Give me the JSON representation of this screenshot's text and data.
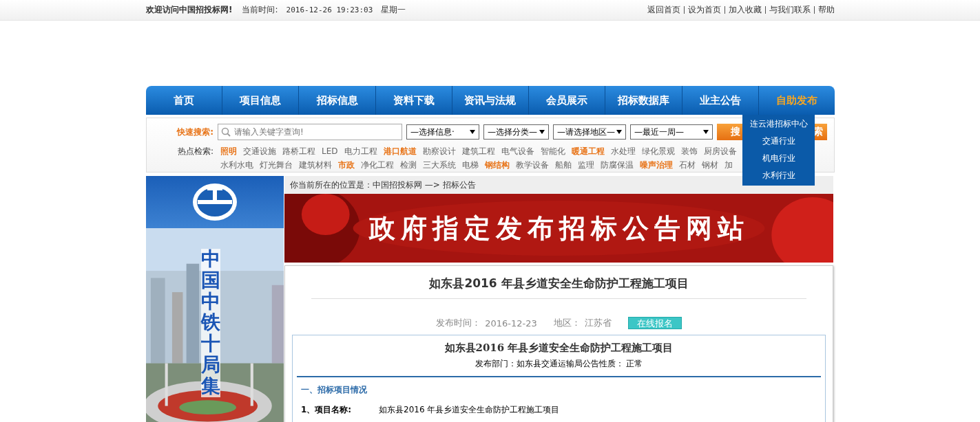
{
  "top_bar": {
    "welcome": "欢迎访问中国招投标网!",
    "time_label": "当前时间:",
    "time": "2016-12-26 19:23:03",
    "weekday": "星期一",
    "links": [
      "返回首页",
      "设为首页",
      "加入收藏",
      "与我们联系",
      "帮助"
    ]
  },
  "nav": [
    {
      "label": "首页",
      "highlight": false
    },
    {
      "label": "项目信息",
      "highlight": false
    },
    {
      "label": "招标信息",
      "highlight": false
    },
    {
      "label": "资料下载",
      "highlight": false
    },
    {
      "label": "资讯与法规",
      "highlight": false
    },
    {
      "label": "会员展示",
      "highlight": false
    },
    {
      "label": "招标数据库",
      "highlight": false
    },
    {
      "label": "业主公告",
      "highlight": false
    },
    {
      "label": "自助发布",
      "highlight": true
    }
  ],
  "dropdown": [
    "连云港招标中心",
    "交通行业",
    "机电行业",
    "水利行业"
  ],
  "search": {
    "label": "快速搜索:",
    "placeholder": "请输入关键字查询!",
    "selects": [
      "—选择信息·",
      "—选择分类—",
      "—请选择地区—",
      "—最近一周—"
    ],
    "button_parts": [
      "搜",
      "索"
    ]
  },
  "hot": {
    "label": "热点检索:",
    "keywords": [
      {
        "t": "照明",
        "hot": true
      },
      {
        "t": "交通设施",
        "hot": false
      },
      {
        "t": "路桥工程",
        "hot": false
      },
      {
        "t": "LED",
        "hot": false
      },
      {
        "t": "电力工程",
        "hot": false
      },
      {
        "t": "港口航道",
        "hot": true
      },
      {
        "t": "勘察设计",
        "hot": false
      },
      {
        "t": "建筑工程",
        "hot": false
      },
      {
        "t": "电气设备",
        "hot": false
      },
      {
        "t": "智能化",
        "hot": false
      },
      {
        "t": "暖通工程",
        "hot": true
      },
      {
        "t": "水处理",
        "hot": false
      },
      {
        "t": "绿化景观",
        "hot": false
      },
      {
        "t": "装饰",
        "hot": false
      },
      {
        "t": "厨房设备",
        "hot": false
      },
      {
        "t": "水利水电",
        "hot": false,
        "new_line": true
      },
      {
        "t": "灯光舞台",
        "hot": false
      },
      {
        "t": "建筑材料",
        "hot": false
      },
      {
        "t": "市政",
        "hot": true
      },
      {
        "t": "净化工程",
        "hot": false
      },
      {
        "t": "检测",
        "hot": false
      },
      {
        "t": "三大系统",
        "hot": false
      },
      {
        "t": "电梯",
        "hot": false
      },
      {
        "t": "钢结构",
        "hot": true
      },
      {
        "t": "教学设备",
        "hot": false
      },
      {
        "t": "船舶",
        "hot": false
      },
      {
        "t": "监理",
        "hot": false
      },
      {
        "t": "防腐保温",
        "hot": false
      },
      {
        "t": "噪声治理",
        "hot": true
      },
      {
        "t": "石材",
        "hot": false
      },
      {
        "t": "钢材",
        "hot": false
      },
      {
        "t": "加",
        "hot": false
      }
    ]
  },
  "side_banner": {
    "vertical_text": "中国中铁十局集"
  },
  "breadcrumb": "你当前所在的位置是：中国招投标网 —> 招标公告",
  "banner": {
    "text": "政府指定发布招标公告网站"
  },
  "article": {
    "title": "如东县2016 年县乡道安全生命防护工程施工项目",
    "meta": [
      {
        "label": "发布时间：",
        "value": "2016-12-23"
      },
      {
        "label": "地区：",
        "value": "江苏省"
      }
    ],
    "signup": "在线报名",
    "inner_title": "如东县2016 年县乡道安全生命防护工程施工项目",
    "department": "发布部门：如东县交通运输局公告性质： 正常",
    "section": "一、招标项目情况",
    "rows": [
      {
        "label": "1、项目名称:",
        "value": "如东县2016 年县乡道安全生命防护工程施工项目"
      }
    ]
  }
}
